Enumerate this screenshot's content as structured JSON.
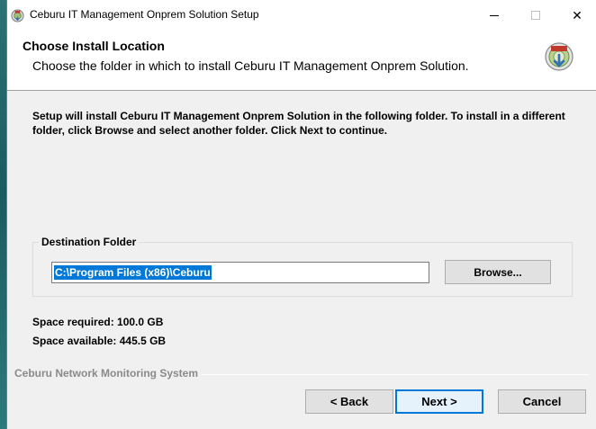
{
  "window": {
    "title": "Ceburu IT Management Onprem Solution Setup",
    "minimize_icon": "minimize-icon",
    "maximize_icon": "maximize-icon",
    "close_icon": "close-icon",
    "close_glyph": "✕"
  },
  "header": {
    "title": "Choose Install Location",
    "subtitle": "Choose the folder in which to install Ceburu IT Management Onprem Solution.",
    "logo_icon": "installer-disk-icon"
  },
  "body": {
    "intro": "Setup will install Ceburu IT Management Onprem Solution in the following folder. To install in a different folder, click Browse and select another folder. Click Next to continue.",
    "destination": {
      "group_label": "Destination Folder",
      "path_value": "C:\\Program Files (x86)\\Ceburu",
      "browse_label": "Browse..."
    },
    "space_required": "Space required: 100.0 GB",
    "space_available": "Space available: 445.5 GB"
  },
  "footer": {
    "branding": "Ceburu Network Monitoring System",
    "back_label": "< Back",
    "next_label": "Next >",
    "cancel_label": "Cancel"
  },
  "colors": {
    "selection": "#0078d7",
    "desktop": "#1e5f66",
    "dialog_bg": "#f0f0f0"
  }
}
